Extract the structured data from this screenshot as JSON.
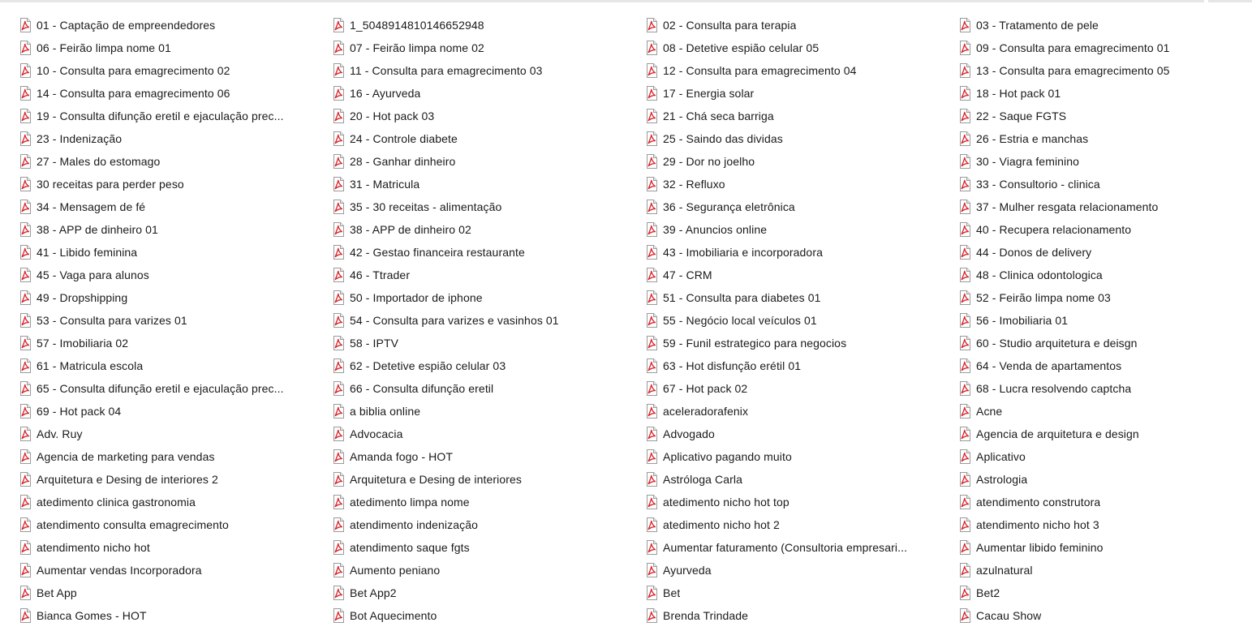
{
  "colors": {
    "pdf_red": "#d8232a",
    "text": "#1a1a1a",
    "background": "#ffffff"
  },
  "file_icon": "pdf-file-icon",
  "files": [
    "01 - Captação de empreendedores",
    "1_5048914810146652948",
    "02 - Consulta para terapia",
    "03 - Tratamento de pele",
    "06 - Feirão limpa nome 01",
    "07 - Feirão limpa nome 02",
    "08 - Detetive espião celular 05",
    "09 - Consulta para emagrecimento 01",
    "10 - Consulta para emagrecimento 02",
    "11 - Consulta para emagrecimento 03",
    "12 - Consulta para emagrecimento 04",
    "13 - Consulta para emagrecimento 05",
    "14 - Consulta para emagrecimento 06",
    "16 - Ayurveda",
    "17 - Energia solar",
    "18 - Hot pack 01",
    "19 - Consulta difunção eretil e ejaculação prec...",
    "20 - Hot pack 03",
    "21 - Chá seca barriga",
    "22 - Saque FGTS",
    "23 - Indenização",
    "24 - Controle diabete",
    "25 - Saindo das dividas",
    "26 - Estria e manchas",
    "27 - Males do estomago",
    "28 - Ganhar dinheiro",
    "29 - Dor no joelho",
    "30 - Viagra feminino",
    "30 receitas para perder peso",
    "31 - Matricula",
    "32 - Refluxo",
    "33 - Consultorio - clinica",
    "34 - Mensagem de fé",
    "35 - 30 receitas - alimentação",
    "36 - Segurança eletrônica",
    "37 - Mulher resgata relacionamento",
    "38 - APP de dinheiro 01",
    "38 - APP de dinheiro 02",
    "39 - Anuncios online",
    "40 - Recupera relacionamento",
    "41 - Libido feminina",
    "42 - Gestao financeira restaurante",
    "43 - Imobiliaria e incorporadora",
    "44 - Donos de delivery",
    "45 - Vaga para alunos",
    "46 - Ttrader",
    "47 - CRM",
    "48 - Clinica odontologica",
    "49 - Dropshipping",
    "50 - Importador de iphone",
    "51 - Consulta para diabetes 01",
    "52 - Feirão limpa nome 03",
    "53 - Consulta para varizes 01",
    "54 - Consulta para varizes e vasinhos 01",
    "55 - Negócio local veículos 01",
    "56 - Imobiliaria 01",
    "57 - Imobiliaria 02",
    "58 - IPTV",
    "59 - Funil estrategico para negocios",
    "60 - Studio arquitetura e deisgn",
    "61 - Matricula escola",
    "62 - Detetive espião celular 03",
    "63 - Hot disfunção erétil 01",
    "64 - Venda de apartamentos",
    "65 - Consulta difunção eretil e ejaculação prec...",
    "66 - Consulta difunção eretil",
    "67 - Hot pack 02",
    "68 - Lucra resolvendo captcha",
    "69 - Hot pack 04",
    "a biblia online",
    "aceleradorafenix",
    "Acne",
    "Adv. Ruy",
    "Advocacia",
    "Advogado",
    "Agencia de arquitetura e design",
    "Agencia de marketing para vendas",
    "Amanda fogo - HOT",
    "Aplicativo pagando muito",
    "Aplicativo",
    "Arquitetura e Desing de interiores 2",
    "Arquitetura e Desing de interiores",
    "Astróloga Carla",
    "Astrologia",
    "atedimento clinica gastronomia",
    "atedimento limpa nome",
    "atedimento nicho hot top",
    "atendimento construtora",
    "atendimento consulta emagrecimento",
    "atendimento indenização",
    "atedimento nicho hot 2",
    "atendimento nicho hot 3",
    "atendimento nicho hot",
    "atendimento saque fgts",
    "Aumentar faturamento (Consultoria empresari...",
    "Aumentar libido feminino",
    "Aumentar vendas Incorporadora",
    "Aumento peniano",
    "Ayurveda",
    "azulnatural",
    "Bet App",
    "Bet App2",
    "Bet",
    "Bet2",
    "Bianca Gomes - HOT",
    "Bot Aquecimento",
    "Brenda Trindade",
    "Cacau Show"
  ]
}
